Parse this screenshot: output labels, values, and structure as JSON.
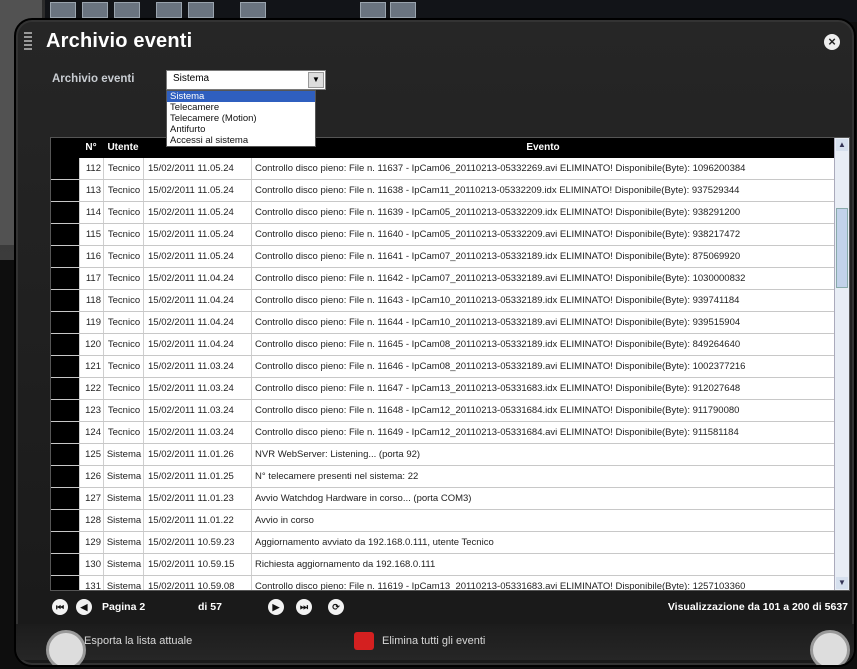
{
  "window": {
    "title": "Archivio eventi",
    "close_icon": "×"
  },
  "filter": {
    "label": "Archivio eventi",
    "selected": "Sistema",
    "options": [
      "Sistema",
      "Telecamere",
      "Telecamere (Motion)",
      "Antifurto",
      "Accessi al sistema"
    ]
  },
  "table": {
    "headers": {
      "num": "N°",
      "user": "Utente",
      "date": "",
      "event": "Evento"
    },
    "rows": [
      [
        "112",
        "Tecnico",
        "15/02/2011 11.05.24",
        "Controllo disco pieno: File n. 11637 - IpCam06_20110213-05332269.avi ELIMINATO! Disponibile(Byte): 1096200384"
      ],
      [
        "113",
        "Tecnico",
        "15/02/2011 11.05.24",
        "Controllo disco pieno: File n. 11638 - IpCam11_20110213-05332209.idx ELIMINATO! Disponibile(Byte): 937529344"
      ],
      [
        "114",
        "Tecnico",
        "15/02/2011 11.05.24",
        "Controllo disco pieno: File n. 11639 - IpCam05_20110213-05332209.idx ELIMINATO! Disponibile(Byte): 938291200"
      ],
      [
        "115",
        "Tecnico",
        "15/02/2011 11.05.24",
        "Controllo disco pieno: File n. 11640 - IpCam05_20110213-05332209.avi ELIMINATO! Disponibile(Byte): 938217472"
      ],
      [
        "116",
        "Tecnico",
        "15/02/2011 11.05.24",
        "Controllo disco pieno: File n. 11641 - IpCam07_20110213-05332189.idx ELIMINATO! Disponibile(Byte): 875069920"
      ],
      [
        "117",
        "Tecnico",
        "15/02/2011 11.04.24",
        "Controllo disco pieno: File n. 11642 - IpCam07_20110213-05332189.avi ELIMINATO! Disponibile(Byte): 1030000832"
      ],
      [
        "118",
        "Tecnico",
        "15/02/2011 11.04.24",
        "Controllo disco pieno: File n. 11643 - IpCam10_20110213-05332189.idx ELIMINATO! Disponibile(Byte): 939741184"
      ],
      [
        "119",
        "Tecnico",
        "15/02/2011 11.04.24",
        "Controllo disco pieno: File n. 11644 - IpCam10_20110213-05332189.avi ELIMINATO! Disponibile(Byte): 939515904"
      ],
      [
        "120",
        "Tecnico",
        "15/02/2011 11.04.24",
        "Controllo disco pieno: File n. 11645 - IpCam08_20110213-05332189.idx ELIMINATO! Disponibile(Byte): 849264640"
      ],
      [
        "121",
        "Tecnico",
        "15/02/2011 11.03.24",
        "Controllo disco pieno: File n. 11646 - IpCam08_20110213-05332189.avi ELIMINATO! Disponibile(Byte): 1002377216"
      ],
      [
        "122",
        "Tecnico",
        "15/02/2011 11.03.24",
        "Controllo disco pieno: File n. 11647 - IpCam13_20110213-05331683.idx ELIMINATO! Disponibile(Byte): 912027648"
      ],
      [
        "123",
        "Tecnico",
        "15/02/2011 11.03.24",
        "Controllo disco pieno: File n. 11648 - IpCam12_20110213-05331684.idx ELIMINATO! Disponibile(Byte): 911790080"
      ],
      [
        "124",
        "Tecnico",
        "15/02/2011 11.03.24",
        "Controllo disco pieno: File n. 11649 - IpCam12_20110213-05331684.avi ELIMINATO! Disponibile(Byte): 911581184"
      ],
      [
        "125",
        "Sistema",
        "15/02/2011 11.01.26",
        "NVR WebServer: Listening... (porta 92)"
      ],
      [
        "126",
        "Sistema",
        "15/02/2011 11.01.25",
        "N° telecamere presenti nel sistema: 22"
      ],
      [
        "127",
        "Sistema",
        "15/02/2011 11.01.23",
        "Avvio Watchdog Hardware in corso... (porta COM3)"
      ],
      [
        "128",
        "Sistema",
        "15/02/2011 11.01.22",
        "Avvio in corso"
      ],
      [
        "129",
        "Sistema",
        "15/02/2011 10.59.23",
        "Aggiornamento avviato da 192.168.0.111, utente Tecnico"
      ],
      [
        "130",
        "Sistema",
        "15/02/2011 10.59.15",
        "Richiesta aggiornamento da 192.168.0.111"
      ],
      [
        "131",
        "Sistema",
        "15/02/2011 10.59.08",
        "Controllo disco pieno: File n. 11619 - IpCam13_20110213-05331683.avi ELIMINATO! Disponibile(Byte): 1257103360"
      ]
    ]
  },
  "pager": {
    "page_label": "Pagina 2",
    "of_label": "di 57",
    "summary": "Visualizzazione da 101 a 200 di 5637"
  },
  "footer": {
    "export_label": "Esporta la lista attuale",
    "delete_label": "Elimina tutti gli eventi"
  },
  "colors": {
    "accent": "#2f5fbf",
    "header_bg": "#000000",
    "delete_red": "#d42020"
  }
}
